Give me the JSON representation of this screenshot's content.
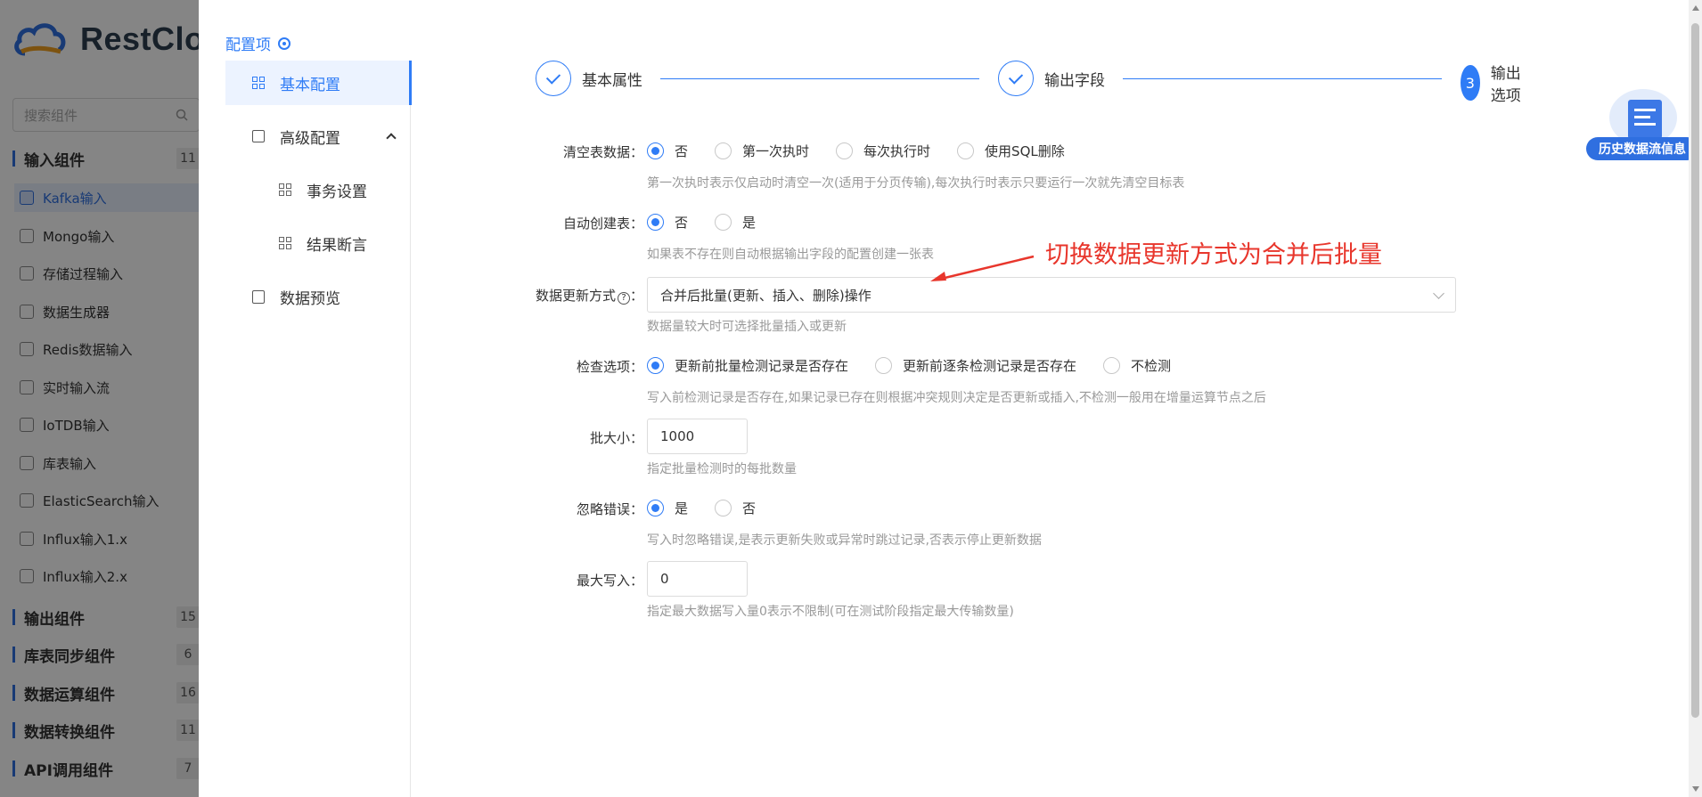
{
  "background": {
    "brand": "RestCloud",
    "search_placeholder": "搜索组件",
    "groups": [
      {
        "label": "输入组件",
        "count": "11"
      },
      {
        "label": "输出组件",
        "count": "15"
      },
      {
        "label": "库表同步组件",
        "count": "6"
      },
      {
        "label": "数据运算组件",
        "count": "16"
      },
      {
        "label": "数据转换组件",
        "count": "11"
      },
      {
        "label": "API调用组件",
        "count": "7"
      }
    ],
    "items": [
      {
        "label": "Kafka输入",
        "active": true
      },
      {
        "label": "Mongo输入"
      },
      {
        "label": "存储过程输入"
      },
      {
        "label": "数据生成器"
      },
      {
        "label": "Redis数据输入"
      },
      {
        "label": "实时输入流"
      },
      {
        "label": "IoTDB输入"
      },
      {
        "label": "库表输入"
      },
      {
        "label": "ElasticSearch输入"
      },
      {
        "label": "Influx输入1.x"
      },
      {
        "label": "Influx输入2.x"
      }
    ]
  },
  "drawer": {
    "title": "配置项",
    "nav": {
      "basic": "基本配置",
      "advanced": "高级配置",
      "transaction": "事务设置",
      "assertion": "结果断言",
      "preview": "数据预览"
    },
    "steps": [
      {
        "label": "基本属性",
        "state": "done"
      },
      {
        "label": "输出字段",
        "state": "done"
      },
      {
        "label": "输出选项",
        "state": "current",
        "number": "3"
      }
    ],
    "form": {
      "clear_table": {
        "label": "清空表数据：",
        "options": [
          "否",
          "第一次执时",
          "每次执行时",
          "使用SQL删除"
        ],
        "hint": "第一次执时表示仅启动时清空一次(适用于分页传输),每次执行时表示只要运行一次就先清空目标表"
      },
      "auto_create": {
        "label": "自动创建表：",
        "options": [
          "否",
          "是"
        ],
        "hint": "如果表不存在则自动根据输出字段的配置创建一张表"
      },
      "update_mode": {
        "label": "数据更新方式",
        "help": "?",
        "colon": "：",
        "value": "合并后批量(更新、插入、删除)操作",
        "hint": "数据量较大时可选择批量插入或更新"
      },
      "check": {
        "label": "检查选项：",
        "options": [
          "更新前批量检测记录是否存在",
          "更新前逐条检测记录是否存在",
          "不检测"
        ],
        "hint": "写入前检测记录是否存在,如果记录已存在则根据冲突规则决定是否更新或插入,不检测一般用在增量运算节点之后"
      },
      "batch_size": {
        "label": "批大小：",
        "value": "1000",
        "hint": "指定批量检测时的每批数量"
      },
      "ignore_error": {
        "label": "忽略错误：",
        "options": [
          "是",
          "否"
        ],
        "hint": "写入时忽略错误,是表示更新失败或异常时跳过记录,否表示停止更新数据"
      },
      "max_write": {
        "label": "最大写入：",
        "value": "0",
        "hint": "指定最大数据写入量0表示不限制(可在测试阶段指定最大传输数量)"
      }
    },
    "annotation": "切换数据更新方式为合并后批量",
    "history_label": "历史数据流信息"
  },
  "colors": {
    "accent": "#2f7cf6",
    "annotation": "#e8362c"
  }
}
